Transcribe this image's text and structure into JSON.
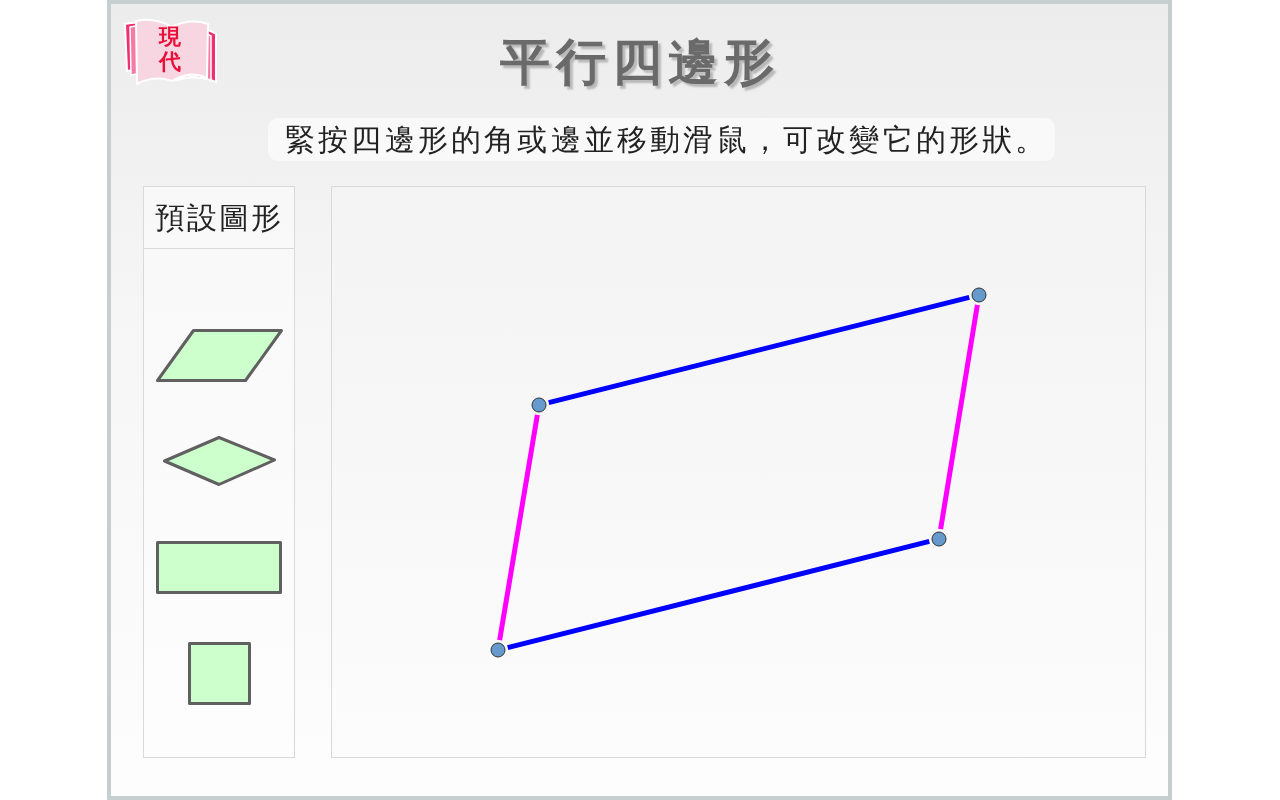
{
  "logo": {
    "text": "現代"
  },
  "title": "平行四邊形",
  "instruction": "緊按四邊形的角或邊並移動滑鼠，可改變它的形狀。",
  "presets_panel": {
    "title": "預設圖形",
    "presets": [
      {
        "kind": "parallelogram"
      },
      {
        "kind": "rhombus"
      },
      {
        "kind": "rectangle"
      },
      {
        "kind": "square"
      }
    ]
  },
  "canvas": {
    "sides": [
      {
        "color": "#0000ff"
      },
      {
        "color": "#ff00ff"
      },
      {
        "color": "#0000ff"
      },
      {
        "color": "#ff00ff"
      }
    ]
  }
}
